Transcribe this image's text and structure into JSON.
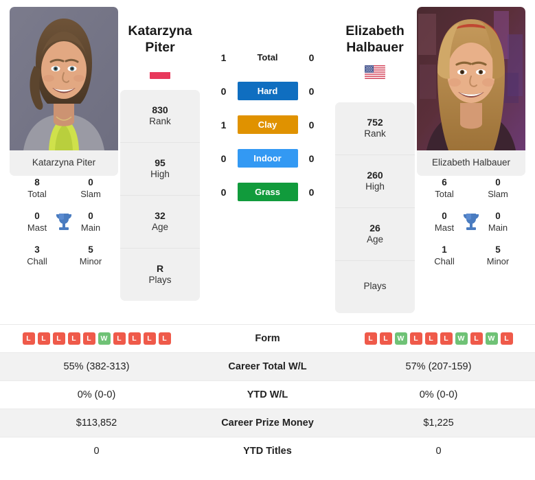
{
  "players": {
    "left": {
      "first_name": "Katarzyna",
      "last_name": "Piter",
      "full_name": "Katarzyna Piter",
      "flag": "poland-flag",
      "rank": "830",
      "rank_label": "Rank",
      "high": "95",
      "high_label": "High",
      "age": "32",
      "age_label": "Age",
      "plays": "R",
      "plays_label": "Plays",
      "titles": {
        "total": "8",
        "total_label": "Total",
        "slam": "0",
        "slam_label": "Slam",
        "mast": "0",
        "mast_label": "Mast",
        "main": "0",
        "main_label": "Main",
        "chall": "3",
        "chall_label": "Chall",
        "minor": "5",
        "minor_label": "Minor"
      }
    },
    "right": {
      "first_name": "Elizabeth",
      "last_name": "Halbauer",
      "full_name": "Elizabeth Halbauer",
      "flag": "usa-flag",
      "rank": "752",
      "rank_label": "Rank",
      "high": "260",
      "high_label": "High",
      "age": "26",
      "age_label": "Age",
      "plays": "",
      "plays_label": "Plays",
      "titles": {
        "total": "6",
        "total_label": "Total",
        "slam": "0",
        "slam_label": "Slam",
        "mast": "0",
        "mast_label": "Mast",
        "main": "0",
        "main_label": "Main",
        "chall": "1",
        "chall_label": "Chall",
        "minor": "5",
        "minor_label": "Minor"
      }
    }
  },
  "surfaces": [
    {
      "label": "Total",
      "left": "1",
      "right": "0",
      "color": "transparent",
      "text_color": "#1a1a1a"
    },
    {
      "label": "Hard",
      "left": "0",
      "right": "0",
      "color": "#0f6ec0",
      "text_color": "#ffffff"
    },
    {
      "label": "Clay",
      "left": "1",
      "right": "0",
      "color": "#e09200",
      "text_color": "#ffffff"
    },
    {
      "label": "Indoor",
      "left": "0",
      "right": "0",
      "color": "#3399f3",
      "text_color": "#ffffff"
    },
    {
      "label": "Grass",
      "left": "0",
      "right": "0",
      "color": "#119b3c",
      "text_color": "#ffffff"
    }
  ],
  "table": {
    "form_label": "Form",
    "form_left": [
      "L",
      "L",
      "L",
      "L",
      "L",
      "W",
      "L",
      "L",
      "L",
      "L"
    ],
    "form_right": [
      "L",
      "L",
      "W",
      "L",
      "L",
      "L",
      "W",
      "L",
      "W",
      "L"
    ],
    "rows": [
      {
        "label": "Career Total W/L",
        "left": "55% (382-313)",
        "right": "57% (207-159)"
      },
      {
        "label": "YTD W/L",
        "left": "0% (0-0)",
        "right": "0% (0-0)"
      },
      {
        "label": "Career Prize Money",
        "left": "$113,852",
        "right": "$1,225"
      },
      {
        "label": "YTD Titles",
        "left": "0",
        "right": "0"
      }
    ]
  },
  "colors": {
    "win_badge": "#6fc276",
    "loss_badge": "#ef5a4a",
    "card_bg": "#f0f0f0",
    "row_shade": "#f2f2f2"
  }
}
